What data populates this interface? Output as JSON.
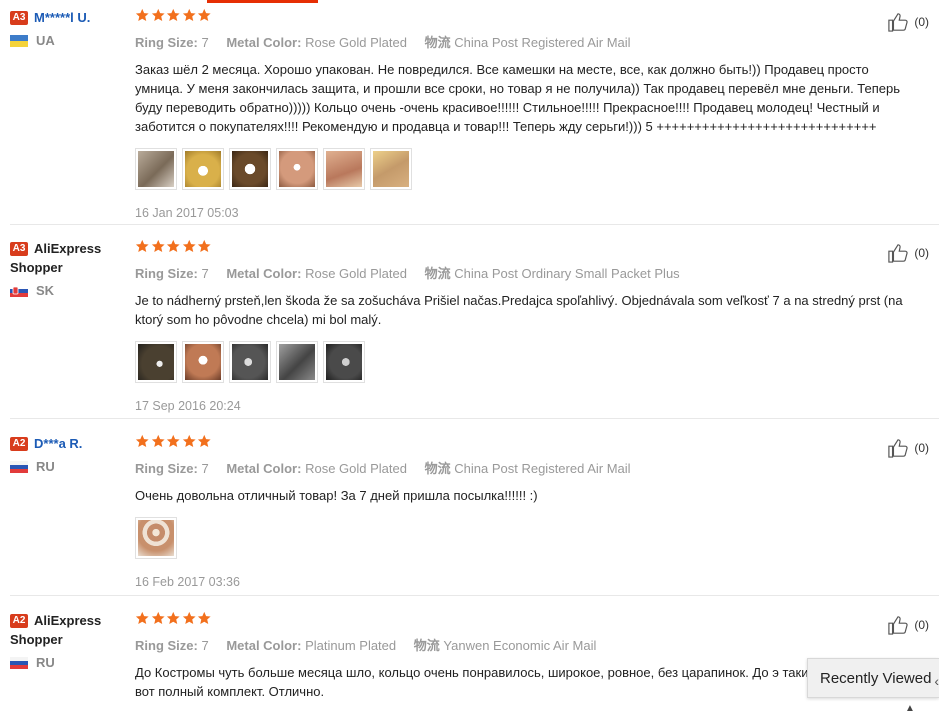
{
  "labels": {
    "ring_size": "Ring Size:",
    "metal_color": "Metal Color:",
    "shipping": "物流",
    "recently_viewed": "Recently Viewed"
  },
  "colors": {
    "accent": "#e62e04",
    "star": "#f2701d",
    "level_badge": "#d83c1c",
    "link": "#1c5bb5"
  },
  "reviews": [
    {
      "level": "A3",
      "name": "M*****l U.",
      "shopper": "",
      "country": "UA",
      "rating": 5,
      "ring_size": "7",
      "metal_color": "Rose Gold Plated",
      "shipping": "China Post Registered Air Mail",
      "text": "Заказ шёл 2 месяца. Хорошо упакован. Не повредился. Все камешки на месте, все, как должно быть!)) Продавец просто умница. У меня закончилась защита, и прошли все сроки, но товар я не получила)) Так продавец перевёл мне деньги. Теперь буду переводить обратно))))) Кольцо очень -очень красивое!!!!!! Стильное!!!!! Прекрасное!!!! Продавец молодец! Честный и заботится о покупателях!!!! Рекомендую и продавца и товар!!! Теперь жду серьги!))) 5 +++++++++++++++++++++++++++++",
      "date": "16 Jan 2017 05:03",
      "helpful": "(0)"
    },
    {
      "level": "A3",
      "name": "AliExpress",
      "shopper": "Shopper",
      "country": "SK",
      "rating": 5,
      "ring_size": "7",
      "metal_color": "Rose Gold Plated",
      "shipping": "China Post Ordinary Small Packet Plus",
      "text": "Je to nádherný prsteň,len škoda že sa zošucháva Prišiel načas.Predajca spoľahlivý. Objednávala som veľkosť 7 a na stredný prst (na ktorý som ho pôvodne chcela) mi bol malý.",
      "date": "17 Sep 2016 20:24",
      "helpful": "(0)"
    },
    {
      "level": "A2",
      "name": "D***a R.",
      "shopper": "",
      "country": "RU",
      "rating": 5,
      "ring_size": "7",
      "metal_color": "Rose Gold Plated",
      "shipping": "China Post Registered Air Mail",
      "text": "Очень довольна отличный товар! За 7 дней пришла посылка!!!!!! :)",
      "date": "16 Feb 2017 03:36",
      "helpful": "(0)"
    },
    {
      "level": "A2",
      "name": "AliExpress",
      "shopper": "Shopper",
      "country": "RU",
      "rating": 5,
      "ring_size": "7",
      "metal_color": "Platinum Plated",
      "shipping": "Yanwen Economic Air Mail",
      "text": "До Костромы чуть больше месяца шло, кольцо очень понравилось, широкое, ровное, без царапинок. До э такие же, теперь вот полный комплект. Отлично.",
      "date": "",
      "helpful": "(0)"
    }
  ]
}
